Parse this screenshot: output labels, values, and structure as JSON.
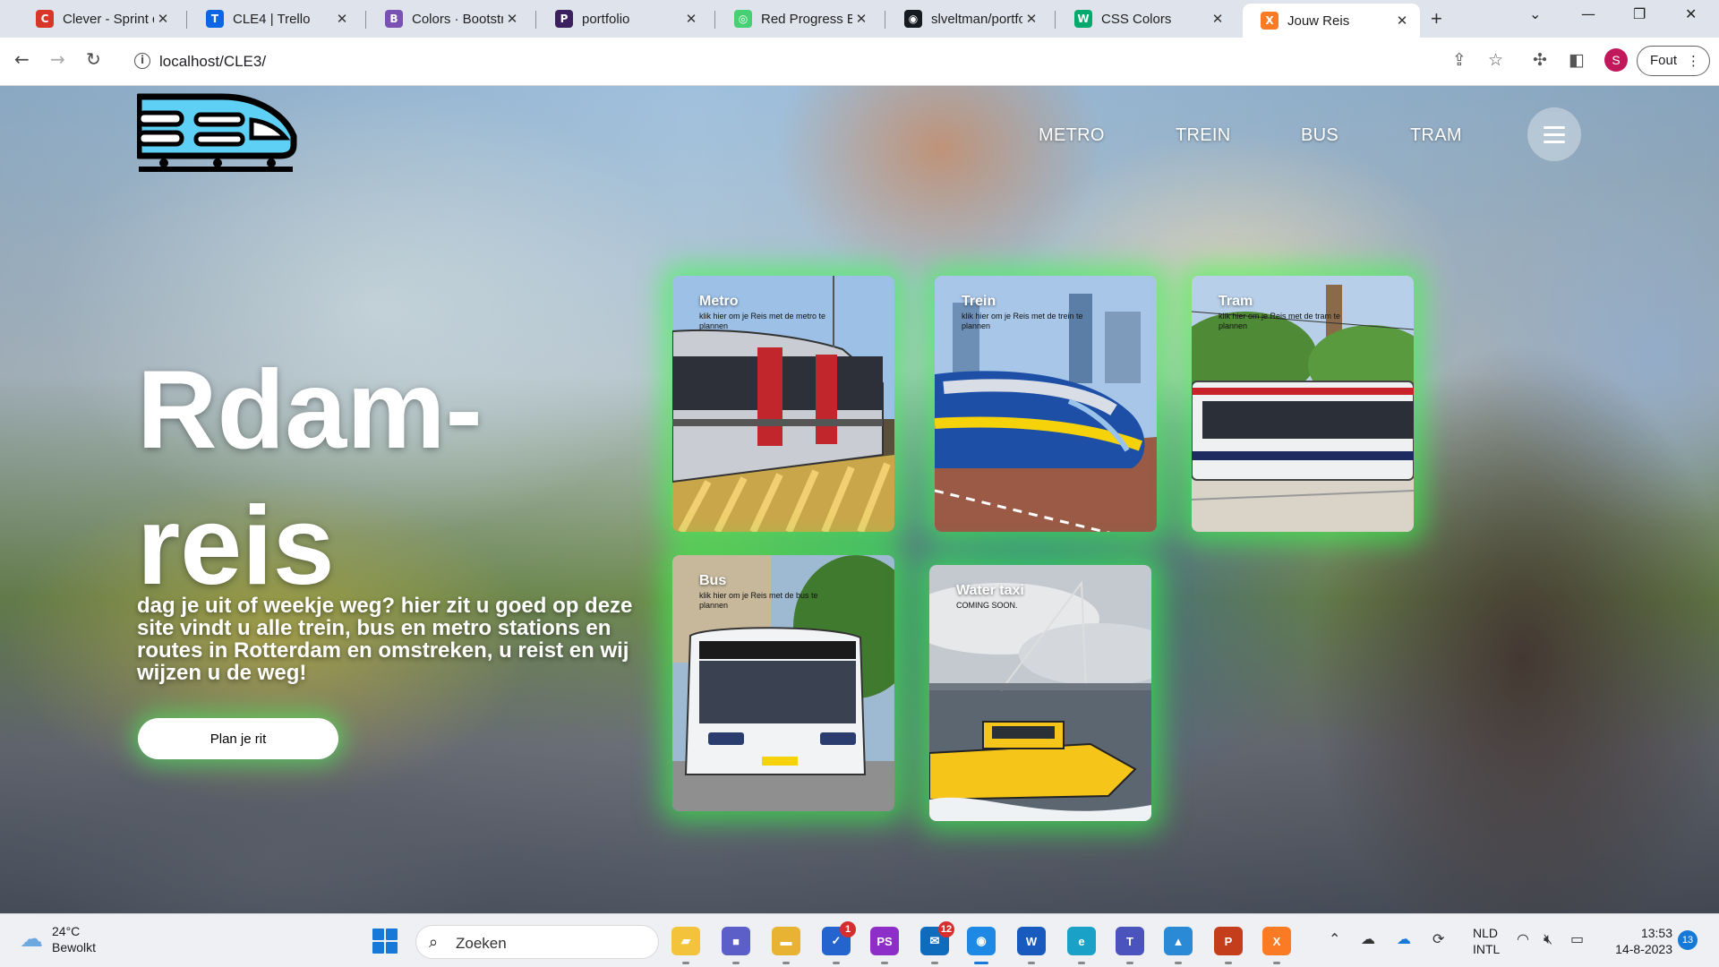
{
  "browser": {
    "tabs": [
      {
        "title": "Clever - Sprint de",
        "icon": "clever-favicon",
        "color": "#d9362a",
        "glyph": "C",
        "active": false
      },
      {
        "title": "CLE4 | Trello",
        "icon": "trello-favicon",
        "color": "#0c66e4",
        "glyph": "T",
        "active": false
      },
      {
        "title": "Colors · Bootstrap",
        "icon": "bootstrap-favicon",
        "color": "#7952b3",
        "glyph": "B",
        "active": false
      },
      {
        "title": "portfolio",
        "icon": "portfolio-favicon",
        "color": "#3b1f5f",
        "glyph": "P",
        "active": false
      },
      {
        "title": "Red Progress Bar",
        "icon": "codepen-favicon",
        "color": "#47cf73",
        "glyph": "◎",
        "active": false
      },
      {
        "title": "slveltman/portfol",
        "icon": "github-favicon",
        "color": "#161b22",
        "glyph": "◉",
        "active": false
      },
      {
        "title": "CSS Colors",
        "icon": "w3schools-favicon",
        "color": "#04aa6d",
        "glyph": "W",
        "active": false
      },
      {
        "title": "Jouw Reis",
        "icon": "xampp-favicon",
        "color": "#fb7a24",
        "glyph": "X",
        "active": true
      }
    ],
    "address": "localhost/CLE3/",
    "error_button": "Fout",
    "profile_initial": "S"
  },
  "page": {
    "nav": [
      "METRO",
      "TREIN",
      "BUS",
      "TRAM"
    ],
    "hero_title": "Rdam-reis",
    "hero_text": "dag je uit of weekje weg? hier zit u goed op deze site vindt u alle trein, bus en metro stations en routes in Rotterdam en omstreken, u reist en wij wijzen u de weg!",
    "cta": "Plan je rit",
    "accent_glow": "#32ff46",
    "cards": [
      {
        "title": "Metro",
        "subtitle": "klik hier om je Reis met de metro te plannen"
      },
      {
        "title": "Trein",
        "subtitle": "klik hier om je Reis met de trein te plannen"
      },
      {
        "title": "Tram",
        "subtitle": "klik hier om je Reis met de tram te plannen"
      },
      {
        "title": "Bus",
        "subtitle": "klik hier om je Reis met de bus te plannen"
      },
      {
        "title": "Water taxi",
        "subtitle": "COMING SOON."
      }
    ]
  },
  "taskbar": {
    "weather_temp": "24°C",
    "weather_desc": "Bewolkt",
    "search_placeholder": "Zoeken",
    "lang_1": "NLD",
    "lang_2": "INTL",
    "time": "13:53",
    "date": "14-8-2023",
    "notifications": "13",
    "apps": [
      {
        "name": "file-explorer-app",
        "color": "#f3c33c",
        "glyph": "▰"
      },
      {
        "name": "teams-video-app",
        "color": "#5b5fc7",
        "glyph": "■"
      },
      {
        "name": "folder-app",
        "color": "#e8b232",
        "glyph": "▬"
      },
      {
        "name": "todo-app",
        "color": "#2564cf",
        "glyph": "✓",
        "badge": "1"
      },
      {
        "name": "phpstorm-app",
        "color": "#8e2ec9",
        "glyph": "PS"
      },
      {
        "name": "mail-app",
        "color": "#0f6cbd",
        "glyph": "✉",
        "badge": "12"
      },
      {
        "name": "chrome-app",
        "color": "#1e88e5",
        "glyph": "◉",
        "active": true
      },
      {
        "name": "word-app",
        "color": "#185abd",
        "glyph": "W"
      },
      {
        "name": "edge-app",
        "color": "#1aa1c7",
        "glyph": "e"
      },
      {
        "name": "teams-app",
        "color": "#4b53bc",
        "glyph": "T"
      },
      {
        "name": "photos-app",
        "color": "#2b8ad6",
        "glyph": "▲"
      },
      {
        "name": "powerpoint-app",
        "color": "#c43e1c",
        "glyph": "P"
      },
      {
        "name": "xampp-app",
        "color": "#fb7a24",
        "glyph": "X"
      }
    ]
  }
}
